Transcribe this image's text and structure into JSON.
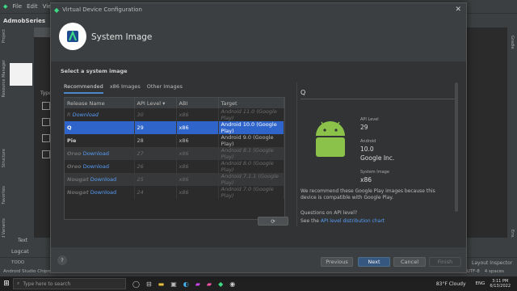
{
  "ide": {
    "menu": [
      "File",
      "Edit",
      "View"
    ],
    "project": "AdmobSeries",
    "project_suffix": "ap",
    "tab_activity": "activit",
    "left_labels": [
      "Project",
      "Resource Manager",
      "Structure",
      "Favorites",
      "Build Variants"
    ],
    "right_labels": [
      "Gradle",
      "Emulator"
    ],
    "panel_type": "Type",
    "text_tab": "Text",
    "logcat": "Logcat",
    "todo": "TODO",
    "status": "Android Studio Chipmunk | 2021.2.1 Patch 1 available // Update... (9 minutes ago)",
    "status_right": [
      "6:1",
      "CRLF",
      "UTF-8",
      "4 spaces"
    ],
    "layout_inspector": "Layout Inspector"
  },
  "taskbar": {
    "search_placeholder": "Type here to search",
    "weather": "83°F Cloudy",
    "lang": "ENG",
    "time": "3:11 PM",
    "date": "6/13/2022"
  },
  "dialog": {
    "window_title": "Virtual Device Configuration",
    "header_title": "System Image",
    "section_label": "Select a system image",
    "tabs": [
      "Recommended",
      "x86 Images",
      "Other Images"
    ],
    "columns": [
      "Release Name",
      "API Level",
      "ABI",
      "Target"
    ],
    "rows": [
      {
        "name": "R",
        "link": "Download",
        "api": "30",
        "abi": "x86",
        "target": "Android 11.0 (Google Play)"
      },
      {
        "name": "Q",
        "link": "",
        "api": "29",
        "abi": "x86",
        "target": "Android 10.0 (Google Play)"
      },
      {
        "name": "Pie",
        "link": "",
        "api": "28",
        "abi": "x86",
        "target": "Android 9.0 (Google Play)"
      },
      {
        "name": "Oreo",
        "link": "Download",
        "api": "27",
        "abi": "x86",
        "target": "Android 8.1 (Google Play)"
      },
      {
        "name": "Oreo",
        "link": "Download",
        "api": "26",
        "abi": "x86",
        "target": "Android 8.0 (Google Play)"
      },
      {
        "name": "Nougat",
        "link": "Download",
        "api": "25",
        "abi": "x86",
        "target": "Android 7.1.1 (Google Play)"
      },
      {
        "name": "Nougat",
        "link": "Download",
        "api": "24",
        "abi": "x86",
        "target": "Android 7.0 (Google Play)"
      }
    ],
    "detail": {
      "title": "Q",
      "api_label": "API Level",
      "api_value": "29",
      "android_label": "Android",
      "android_value": "10.0",
      "vendor": "Google Inc.",
      "sysimg_label": "System Image",
      "sysimg_value": "x86",
      "recommend": "We recommend these Google Play images because this device is compatible with Google Play.",
      "question": "Questions on API level?",
      "see_prefix": "See the",
      "see_link": "API level distribution chart"
    },
    "buttons": {
      "help": "?",
      "previous": "Previous",
      "next": "Next",
      "cancel": "Cancel",
      "finish": "Finish"
    },
    "colors": {
      "accent": "#2f65ca",
      "link": "#589df6",
      "android_green": "#8bc34a"
    }
  }
}
